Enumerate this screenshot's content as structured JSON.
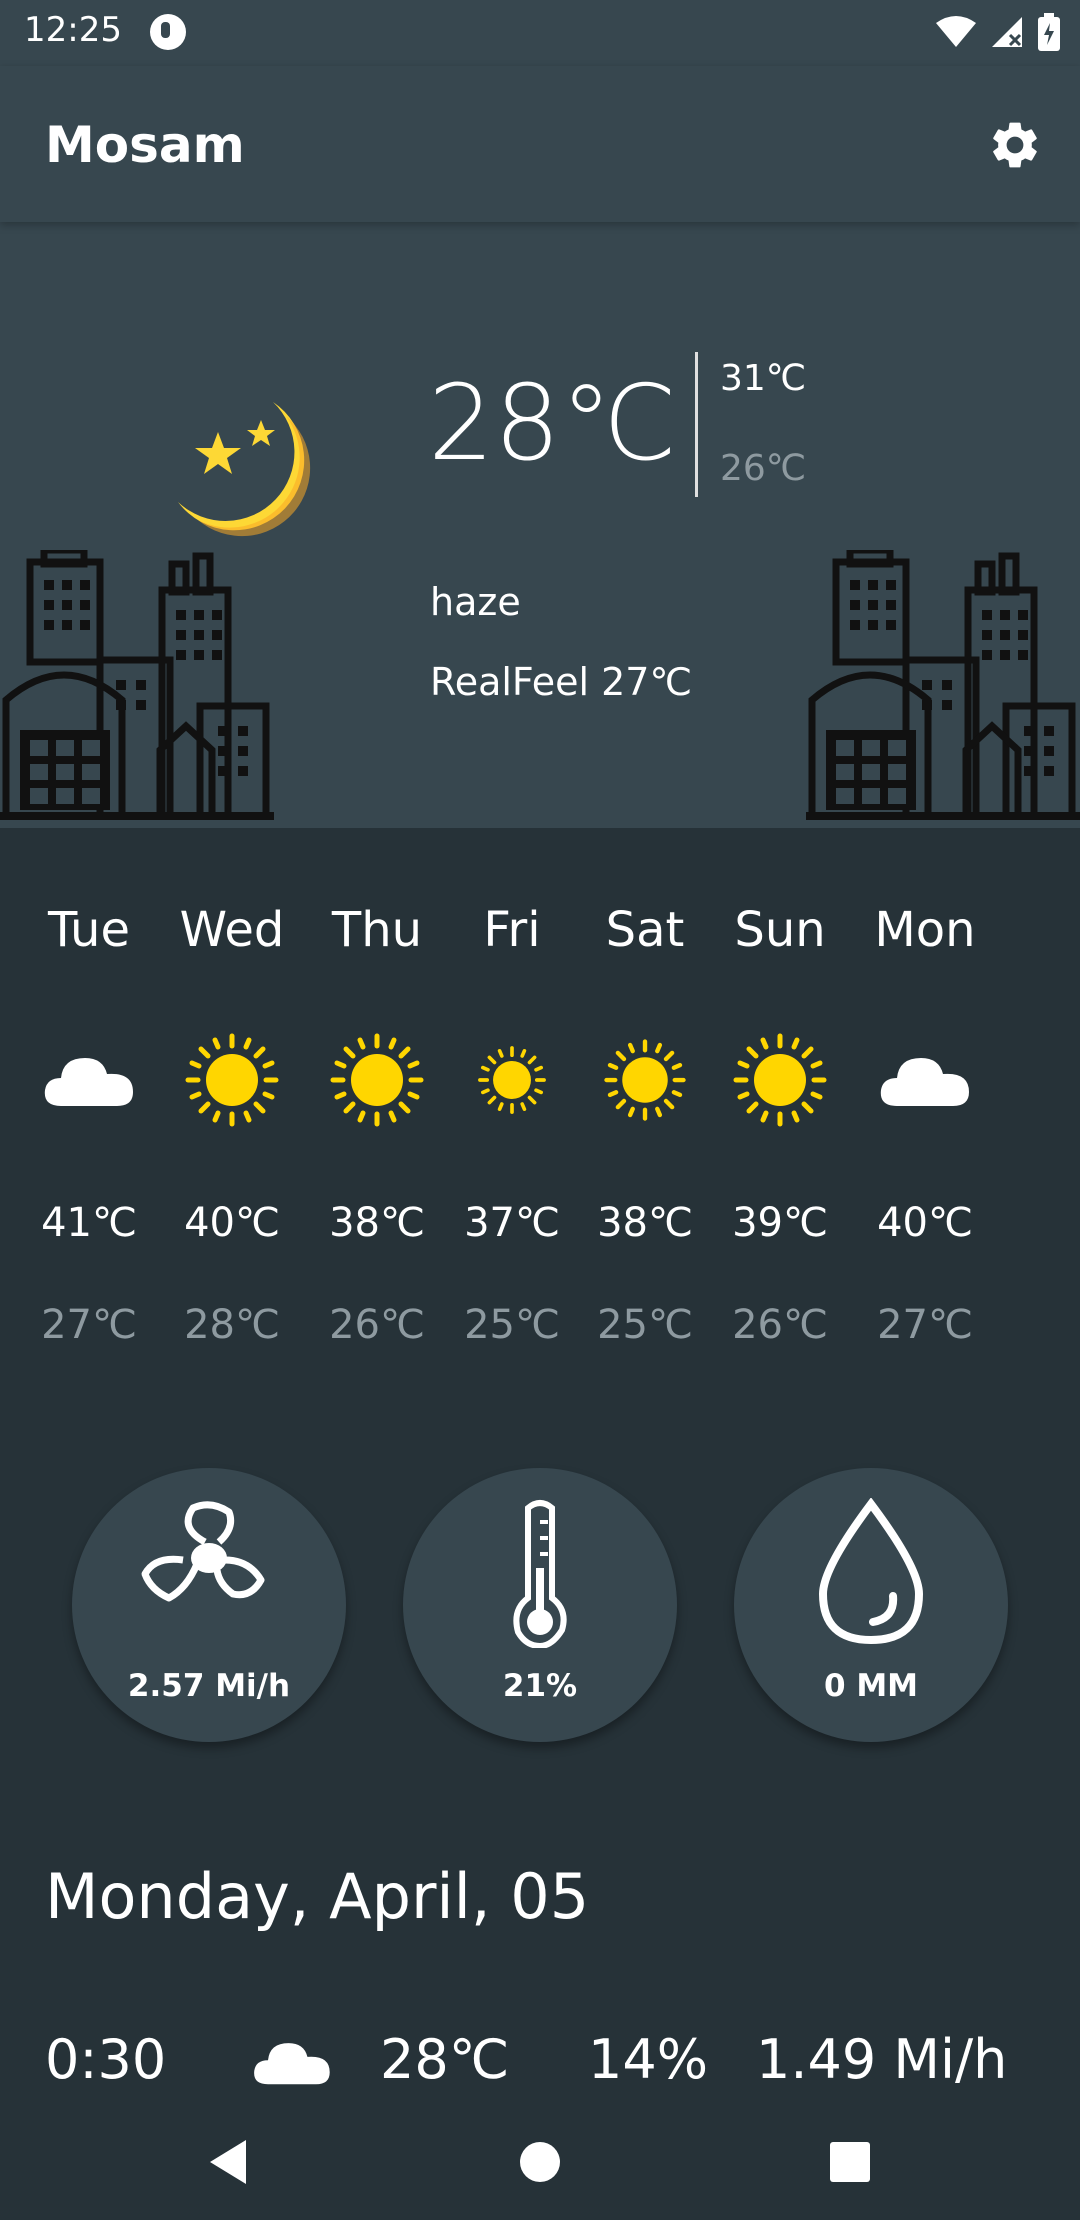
{
  "status": {
    "time": "12:25"
  },
  "app": {
    "title": "Mosam"
  },
  "current": {
    "temp": "28℃",
    "high": "31℃",
    "low": "26℃",
    "condition": "haze",
    "realfeel": "RealFeel 27℃",
    "icon": "moon-stars-icon"
  },
  "forecast": [
    {
      "day": "Tue",
      "icon": "cloud-icon",
      "high": "41℃",
      "low": "27℃"
    },
    {
      "day": "Wed",
      "icon": "sun-icon",
      "high": "40℃",
      "low": "28℃"
    },
    {
      "day": "Thu",
      "icon": "sun-icon",
      "high": "38℃",
      "low": "26℃"
    },
    {
      "day": "Fri",
      "icon": "sun-icon",
      "high": "37℃",
      "low": "25℃"
    },
    {
      "day": "Sat",
      "icon": "sun-icon",
      "high": "38℃",
      "low": "25℃"
    },
    {
      "day": "Sun",
      "icon": "sun-icon",
      "high": "39℃",
      "low": "26℃"
    },
    {
      "day": "Mon",
      "icon": "cloud-icon",
      "high": "40℃",
      "low": "27℃"
    }
  ],
  "metrics": {
    "wind": "2.57 Mi/h",
    "humidity": "21%",
    "precipitation": "0 MM"
  },
  "date": "Monday, April, 05",
  "hourly": {
    "time": "0:30",
    "icon": "cloud-icon",
    "temp": "28℃",
    "humidity": "14%",
    "wind": "1.49 Mi/h"
  },
  "colors": {
    "background": "#263238",
    "surface": "#37474f",
    "sun": "#ffd600",
    "moon": "#fdd835",
    "muted_text": "#8e9aa0"
  }
}
